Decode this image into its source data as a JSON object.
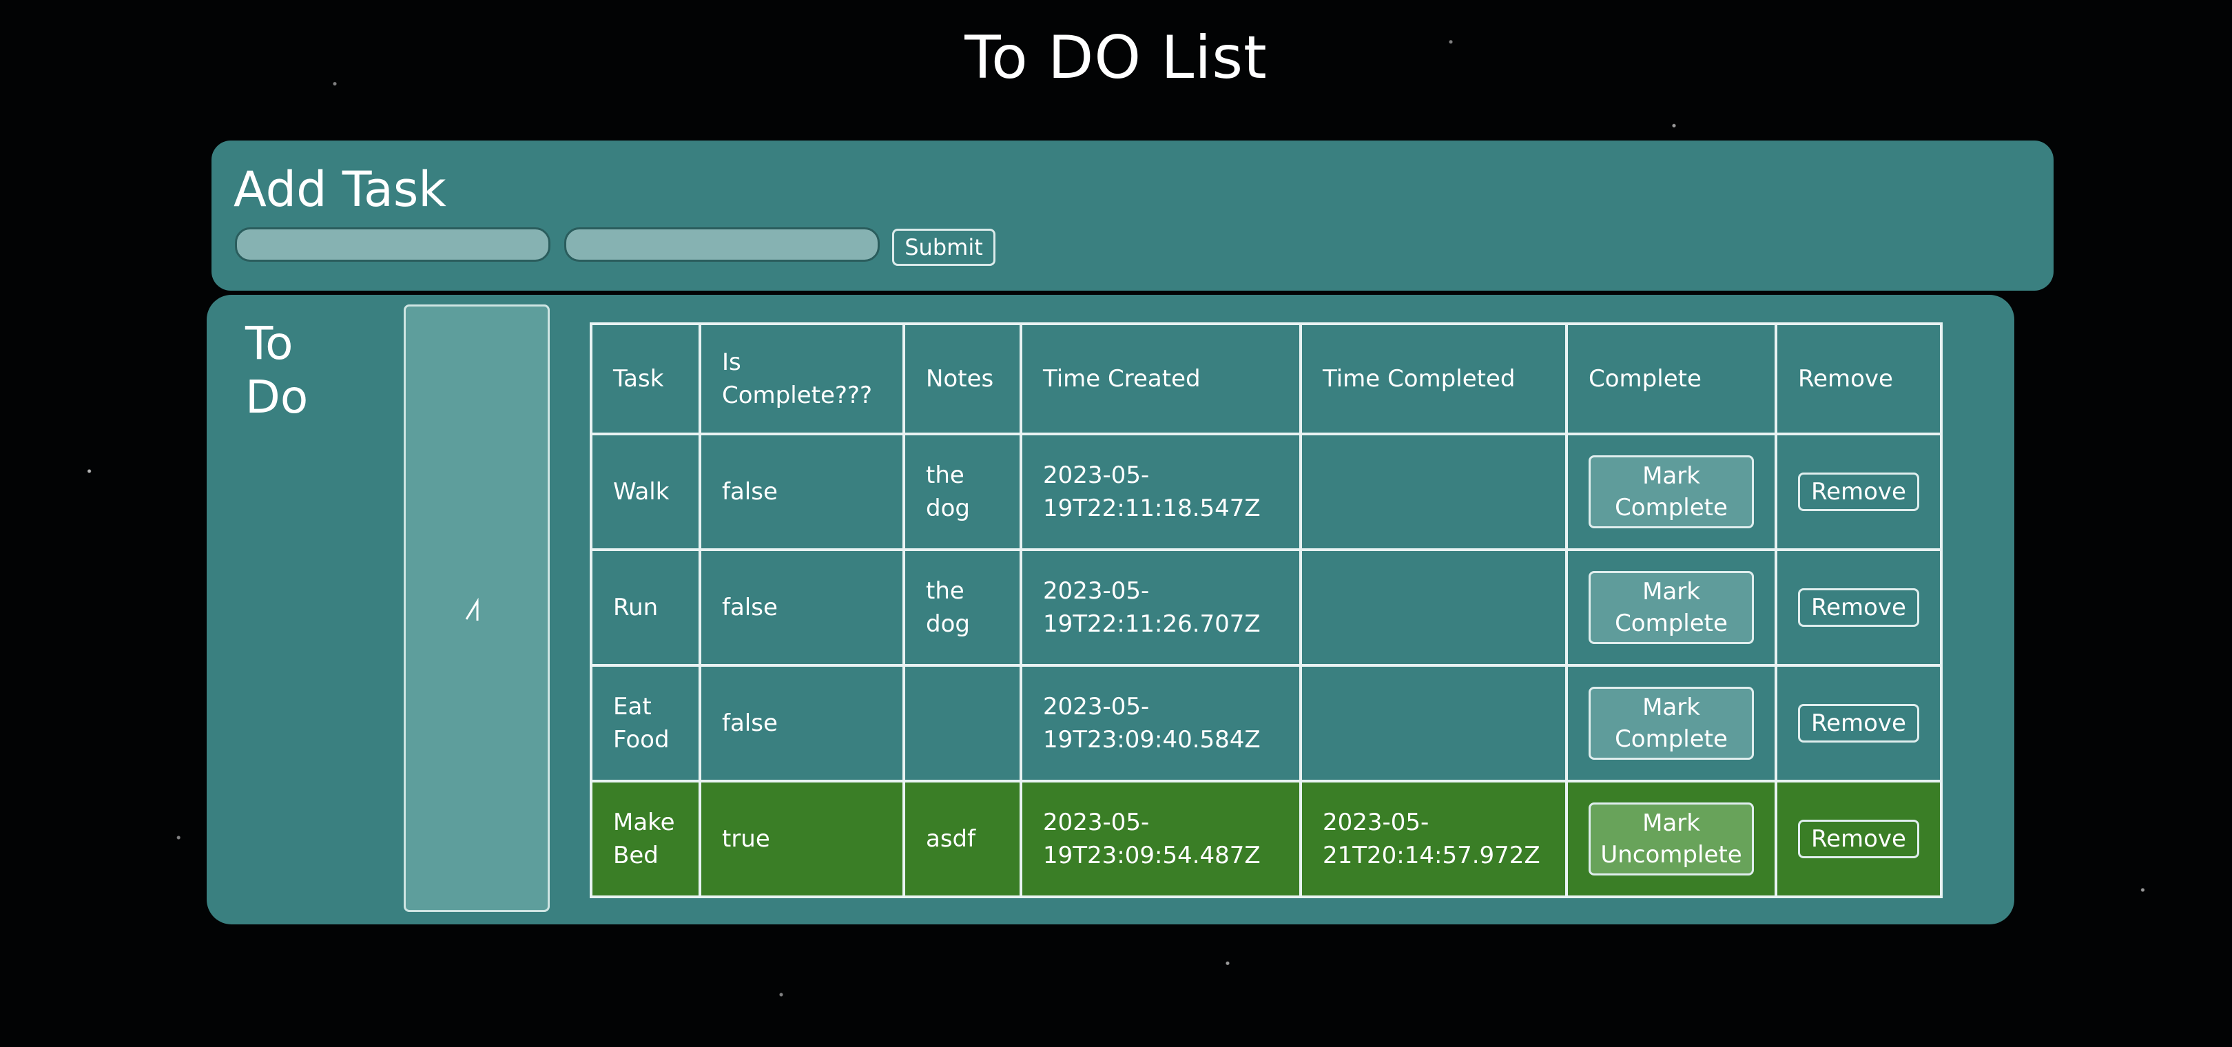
{
  "header": {
    "title": "To DO List"
  },
  "add_task": {
    "heading": "Add Task",
    "task_input_value": "",
    "notes_input_value": "",
    "submit_label": "Submit"
  },
  "todo": {
    "heading": "To Do",
    "sort_icon": "angle-caret-icon",
    "columns": [
      "Task",
      "Is Complete???",
      "Notes",
      "Time Created",
      "Time Completed",
      "Complete",
      "Remove"
    ],
    "rows": [
      {
        "task": "Walk",
        "is_complete": "false",
        "notes": "the dog",
        "time_created": "2023-05-19T22:11:18.547Z",
        "time_completed": "",
        "action_label": "Mark Complete",
        "remove_label": "Remove"
      },
      {
        "task": "Run",
        "is_complete": "false",
        "notes": "the dog",
        "time_created": "2023-05-19T22:11:26.707Z",
        "time_completed": "",
        "action_label": "Mark Complete",
        "remove_label": "Remove"
      },
      {
        "task": "Eat Food",
        "is_complete": "false",
        "notes": "",
        "time_created": "2023-05-19T23:09:40.584Z",
        "time_completed": "",
        "action_label": "Mark Complete",
        "remove_label": "Remove"
      },
      {
        "task": "Make Bed",
        "is_complete": "true",
        "notes": "asdf",
        "time_created": "2023-05-19T23:09:54.487Z",
        "time_completed": "2023-05-21T20:14:57.972Z",
        "action_label": "Mark Uncomplete",
        "remove_label": "Remove"
      }
    ]
  },
  "colors": {
    "panel": "#3a8080",
    "completed_row": "#3a7e26",
    "background": "#000000"
  }
}
